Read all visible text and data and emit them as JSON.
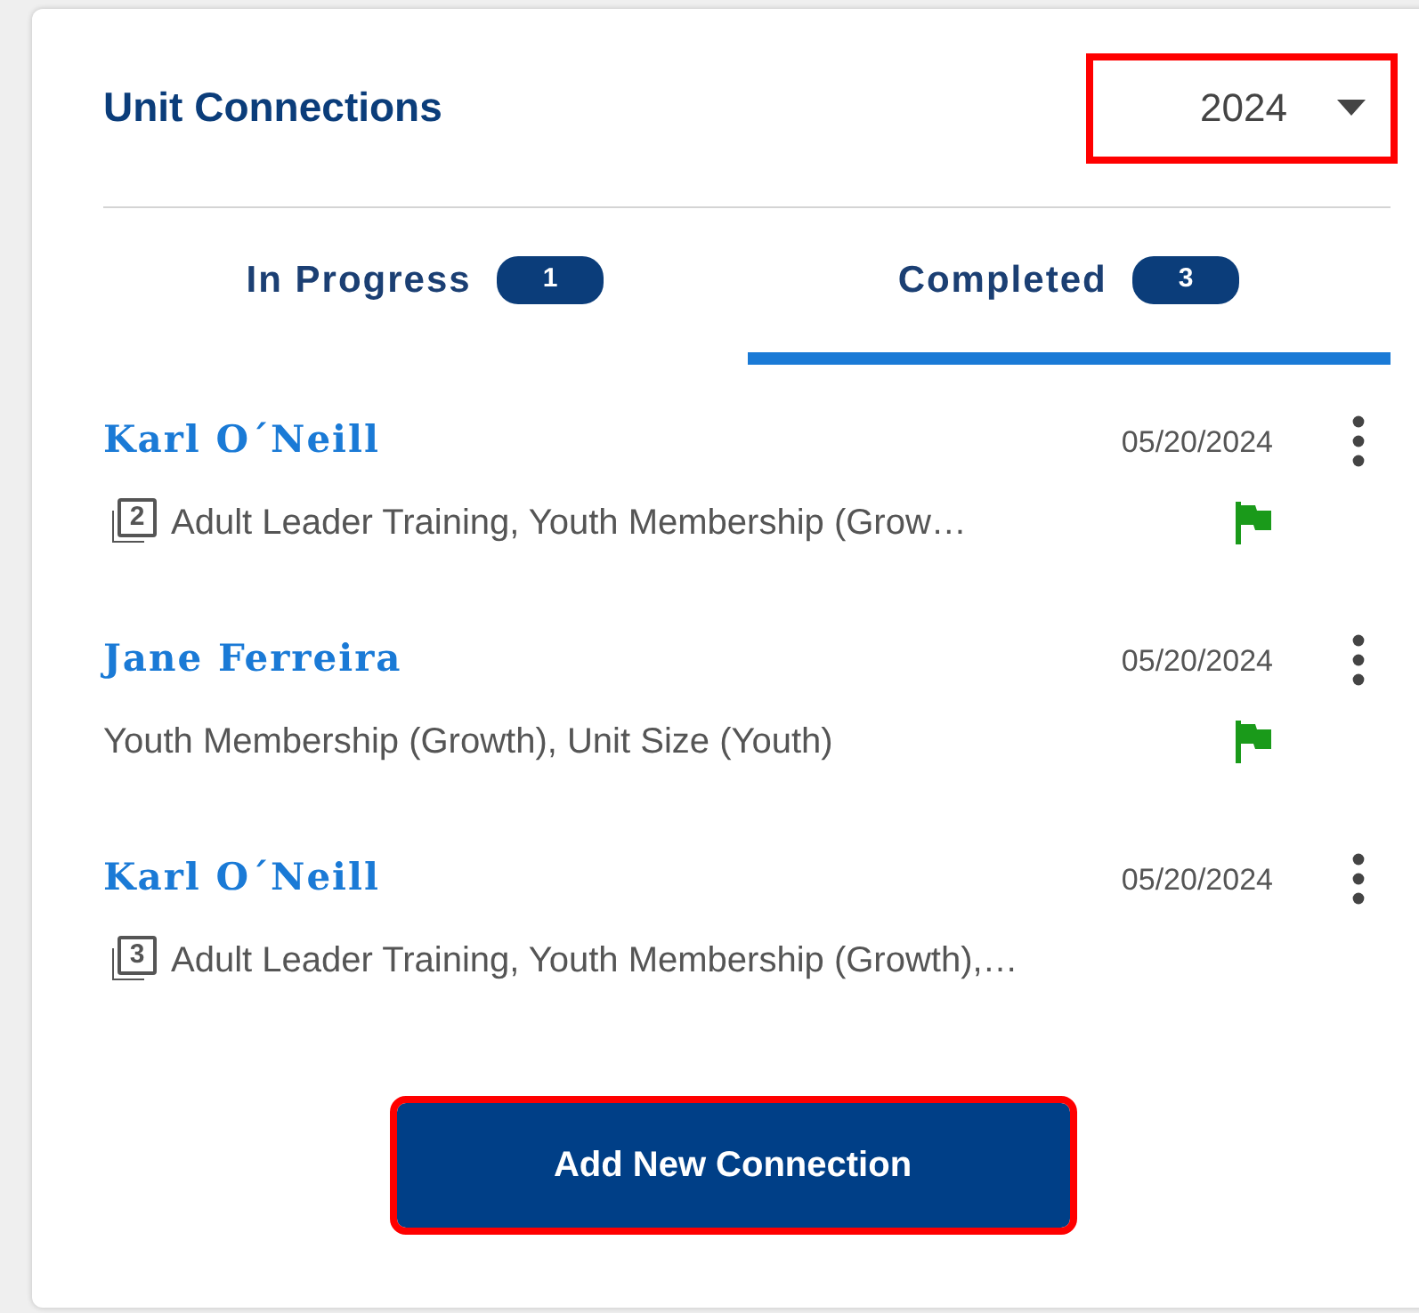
{
  "panel": {
    "title": "Unit Connections",
    "year_select": {
      "value": "2024",
      "highlighted": true
    }
  },
  "tabs": [
    {
      "label": "In Progress",
      "count": "1",
      "selected": false
    },
    {
      "label": "Completed",
      "count": "3",
      "selected": true
    }
  ],
  "connections": [
    {
      "name": "Karl O´Neill",
      "date": "05/20/2024",
      "count_icon": "2",
      "description": "Adult Leader Training, Youth Membership (Grow…",
      "flagged": true
    },
    {
      "name": "Jane Ferreira",
      "date": "05/20/2024",
      "description": "Youth Membership (Growth), Unit Size (Youth)",
      "flagged": true
    },
    {
      "name": "Karl O´Neill",
      "date": "05/20/2024",
      "count_icon": "3",
      "description": "Adult Leader Training, Youth Membership (Growth),…",
      "flagged": false
    }
  ],
  "add_button": {
    "label": "Add New Connection",
    "highlighted": true
  }
}
